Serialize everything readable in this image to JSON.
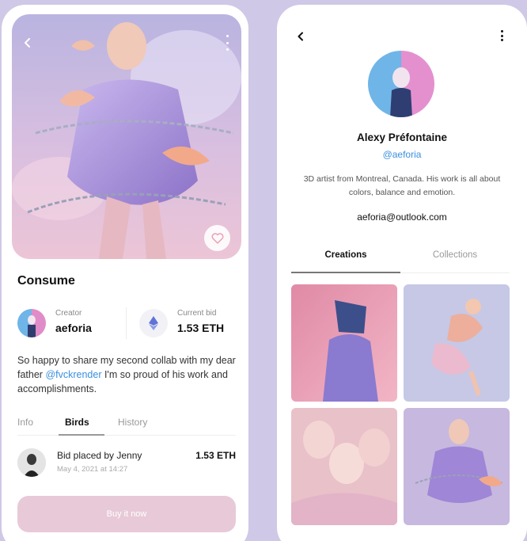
{
  "nft_detail": {
    "title": "Consume",
    "creator": {
      "label": "Creator",
      "name": "aeforia"
    },
    "current_bid": {
      "label": "Current bid",
      "value": "1.53 ETH"
    },
    "description": {
      "before": "So happy to share my second collab with my dear father ",
      "mention": "@fvckrender",
      "after": " I'm so proud of his work and accomplishments."
    },
    "tabs": [
      {
        "label": "Info",
        "active": false
      },
      {
        "label": "Birds",
        "active": true
      },
      {
        "label": "History",
        "active": false
      }
    ],
    "bid": {
      "text": "Bid placed by Jenny",
      "date": "May 4, 2021 at 14:27",
      "amount": "1.53 ETH"
    },
    "buy_button": "Buy it now",
    "icons": {
      "back": "chevron-left-icon",
      "more": "more-vertical-icon",
      "like": "heart-icon",
      "currency": "ethereum-icon"
    }
  },
  "profile": {
    "name": "Alexy Préfontaine",
    "handle": "@aeforia",
    "bio": "3D artist from Montreal, Canada. His work is all about colors, balance and emotion.",
    "email": "aeforia@outlook.com",
    "tabs": [
      {
        "label": "Creations",
        "active": true
      },
      {
        "label": "Collections",
        "active": false
      }
    ],
    "icons": {
      "back": "chevron-left-icon",
      "more": "more-vertical-icon"
    }
  },
  "colors": {
    "background": "#cfc8e6",
    "link": "#3a8fe0",
    "buy_button": "#e8c9d8"
  }
}
